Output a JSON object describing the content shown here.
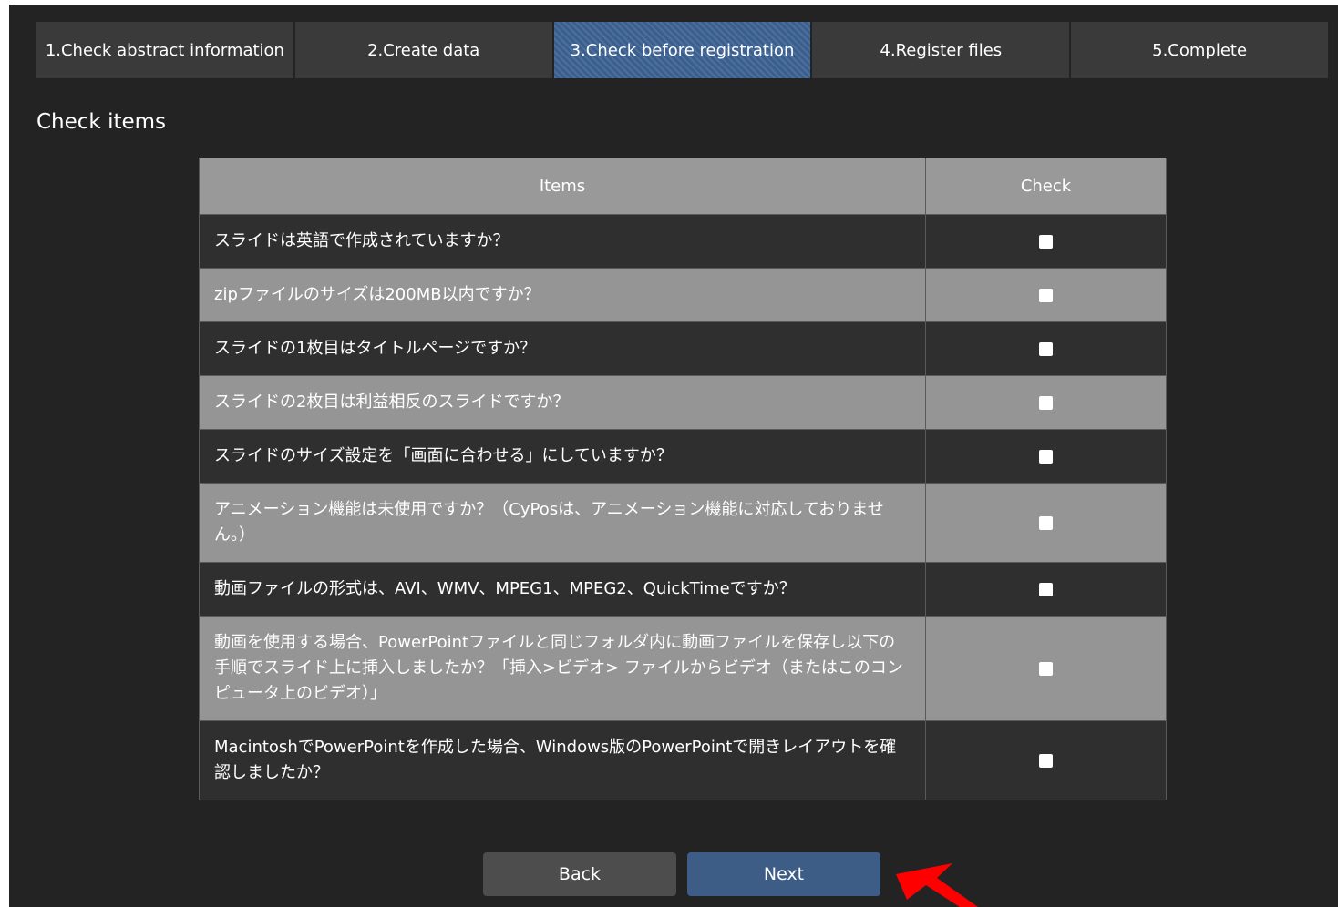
{
  "steps": [
    {
      "label": "1.Check abstract information"
    },
    {
      "label": "2.Create data"
    },
    {
      "label": "3.Check before registration"
    },
    {
      "label": "4.Register files"
    },
    {
      "label": "5.Complete"
    }
  ],
  "active_step": "3.Check before registration",
  "section_title": "Check items",
  "table": {
    "headers": {
      "items": "Items",
      "check": "Check"
    },
    "rows": [
      {
        "text": "スライドは英語で作成されていますか？",
        "checked": false
      },
      {
        "text": "zipファイルのサイズは200MB以内ですか？",
        "checked": false
      },
      {
        "text": "スライドの1枚目はタイトルページですか？",
        "checked": false
      },
      {
        "text": "スライドの2枚目は利益相反のスライドですか？",
        "checked": false
      },
      {
        "text": "スライドのサイズ設定を「画面に合わせる」にしていますか？",
        "checked": false
      },
      {
        "text": "アニメーション機能は未使用ですか？（CyPosは、アニメーション機能に対応しておりません。）",
        "checked": false
      },
      {
        "text": "動画ファイルの形式は、AVI、WMV、MPEG1、MPEG2、QuickTimeですか？",
        "checked": false
      },
      {
        "text": "動画を使用する場合、PowerPointファイルと同じフォルダ内に動画ファイルを保存し以下の手順でスライド上に挿入しましたか？「挿入>ビデオ> ファイルからビデオ（またはこのコンピュータ上のビデオ）」",
        "checked": false
      },
      {
        "text": "MacintoshでPowerPointを作成した場合、Windows版のPowerPointで開きレイアウトを確認しましたか？",
        "checked": false
      }
    ]
  },
  "buttons": {
    "back": "Back",
    "next": "Next"
  },
  "colors": {
    "background": "#232323",
    "step_inactive": "#3a3a3a",
    "step_active": "#3a5f8f",
    "header_row": "#999999",
    "row_dark": "#2f2f2f",
    "row_light": "#959595",
    "back_button": "#4d4d4d",
    "next_button": "#3d5d86",
    "annotation_arrow": "#ff0000"
  },
  "annotation": {
    "icon": "red-arrow-icon"
  }
}
